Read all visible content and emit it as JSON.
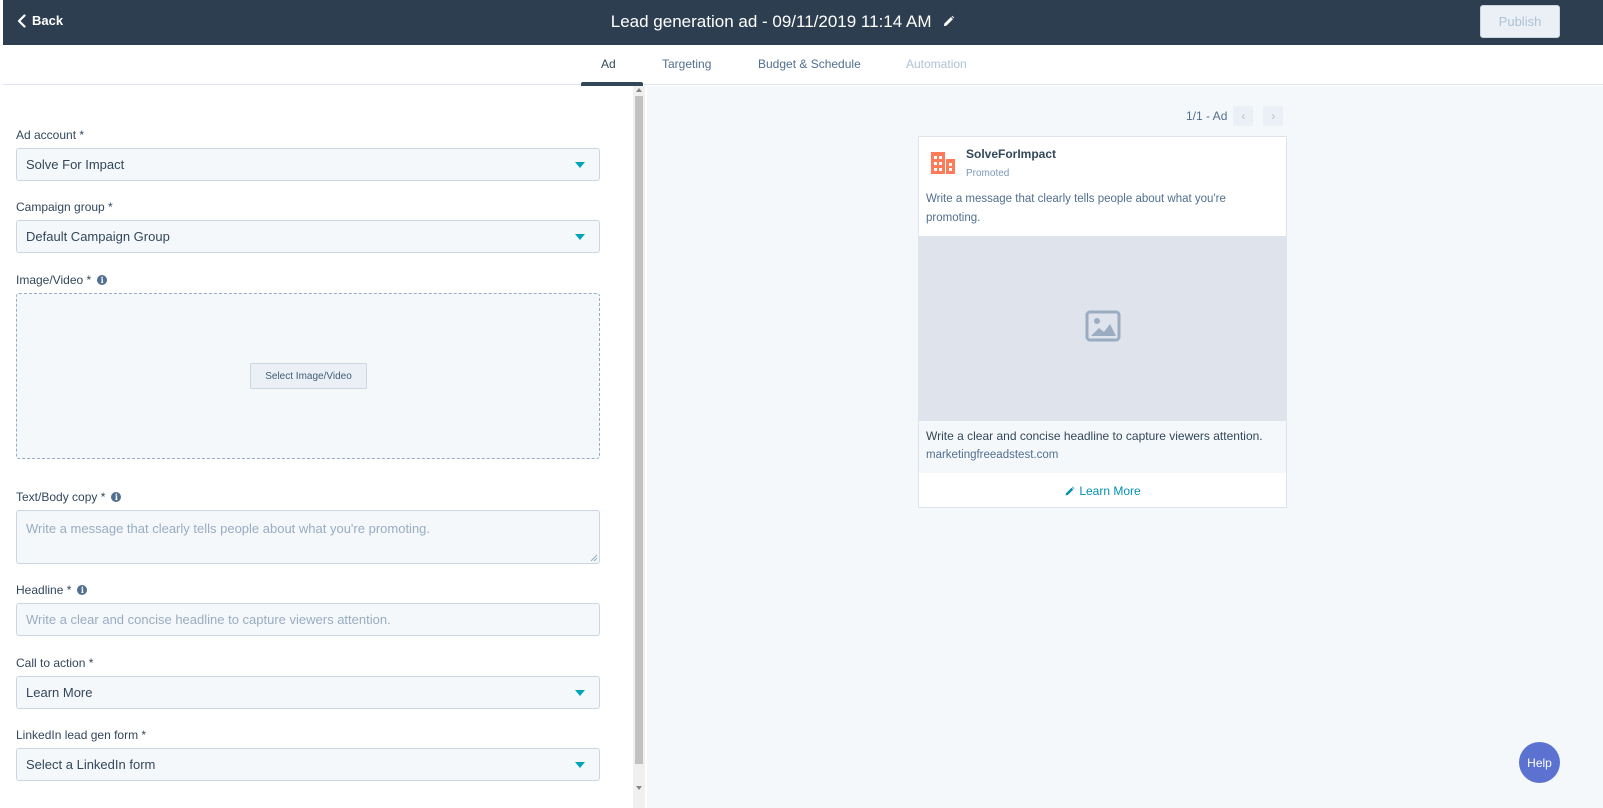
{
  "header": {
    "back_label": "Back",
    "title": "Lead generation ad - 09/11/2019 11:14 AM",
    "publish_label": "Publish"
  },
  "tabs": [
    {
      "label": "Ad",
      "state": "active"
    },
    {
      "label": "Targeting",
      "state": "normal"
    },
    {
      "label": "Budget & Schedule",
      "state": "normal"
    },
    {
      "label": "Automation",
      "state": "disabled"
    }
  ],
  "form": {
    "ad_account": {
      "label": "Ad account *",
      "value": "Solve For Impact"
    },
    "campaign_group": {
      "label": "Campaign group *",
      "value": "Default Campaign Group"
    },
    "image_video": {
      "label": "Image/Video *",
      "button_label": "Select Image/Video"
    },
    "body_copy": {
      "label": "Text/Body copy *",
      "placeholder": "Write a message that clearly tells people about what you're promoting."
    },
    "headline": {
      "label": "Headline *",
      "placeholder": "Write a clear and concise headline to capture viewers attention."
    },
    "call_to_action": {
      "label": "Call to action *",
      "value": "Learn More"
    },
    "lead_gen_form": {
      "label": "LinkedIn lead gen form *",
      "value": "Select a LinkedIn form"
    }
  },
  "preview": {
    "pager": "1/1 - Ad",
    "company": "SolveForImpact",
    "promoted": "Promoted",
    "body": "Write a message that clearly tells people about what you're promoting.",
    "headline": "Write a clear and concise headline to capture viewers attention.",
    "url": "marketingfreeadstest.com",
    "cta": "Learn More"
  },
  "help_label": "Help",
  "colors": {
    "topbar": "#2d3e50",
    "accent": "#00a4bd",
    "logo": "#ff7a59",
    "help": "#5c72d1",
    "link": "#0091ae"
  }
}
